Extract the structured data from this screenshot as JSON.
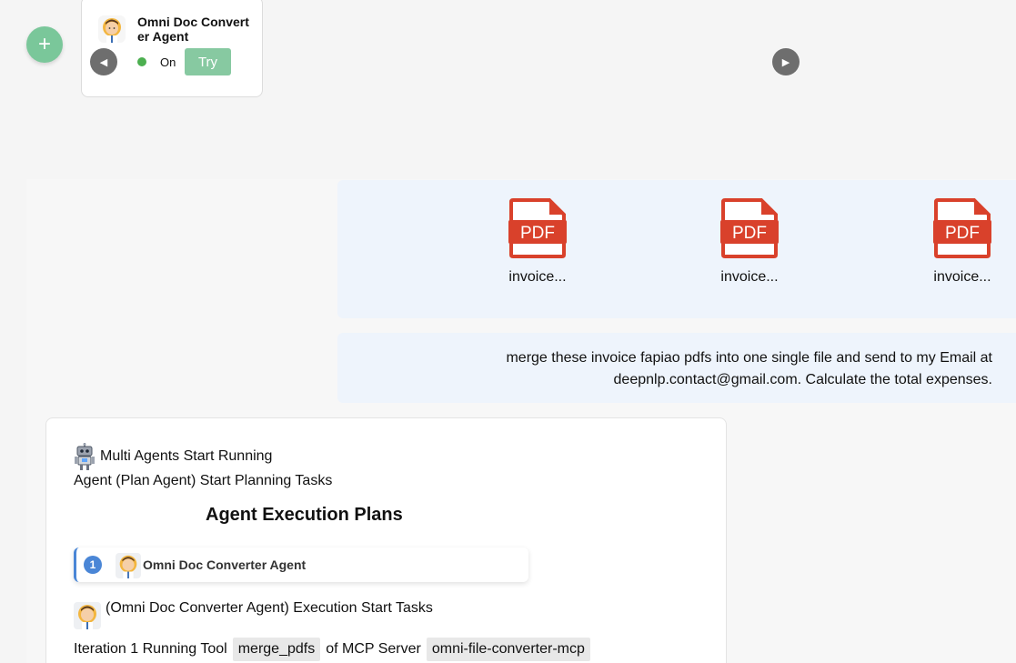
{
  "agent_strip": {
    "agent_name": "Omni Doc Converter Agent",
    "status": "On",
    "try_label": "Try",
    "add_symbol": "+",
    "prev_symbol": "◀",
    "next_symbol": "▶",
    "status_color": "#4caf50",
    "accent_color": "#7ac79a"
  },
  "attachments": {
    "files": [
      {
        "icon": "pdf-icon",
        "name": "invoice..."
      },
      {
        "icon": "pdf-icon",
        "name": "invoice..."
      },
      {
        "icon": "pdf-icon",
        "name": "invoice..."
      }
    ],
    "pdf_color": "#d9412b"
  },
  "user_message": {
    "text": "merge these invoice fapiao pdfs into one single file and send to my Email at deepnlp.contact@gmail.com. Calculate the total expenses."
  },
  "run_panel": {
    "header": "Multi Agents Start Running",
    "plan_line": "Agent (Plan Agent) Start Planning Tasks",
    "plans_title": "Agent Execution Plans",
    "steps": [
      {
        "number": "1",
        "agent": "Omni Doc Converter Agent"
      }
    ],
    "exec_line": "(Omni Doc Converter Agent) Execution Start Tasks",
    "iteration": {
      "prefix": "Iteration 1 Running Tool",
      "tool": "merge_pdfs",
      "middle": "of MCP Server",
      "server": "omni-file-converter-mcp"
    },
    "step_color": "#4a86d6"
  }
}
